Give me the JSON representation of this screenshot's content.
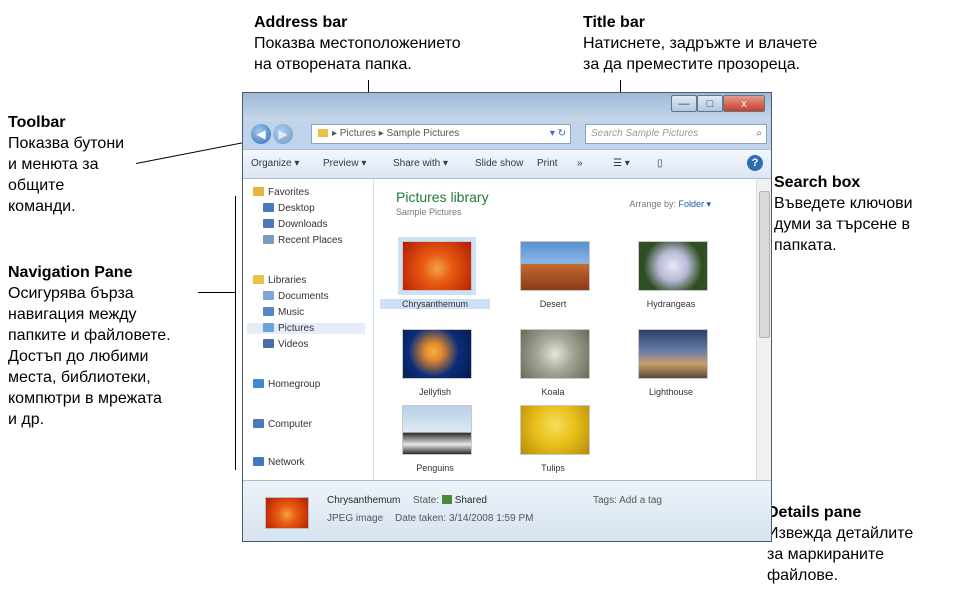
{
  "callouts": {
    "address_bar": {
      "title": "Address bar",
      "lines": [
        "Показва местоположението",
        "на отворената папка."
      ]
    },
    "title_bar": {
      "title": "Title bar",
      "lines": [
        "Натиснете, задръжте и влачете",
        "за да преместите прозореца."
      ]
    },
    "toolbar": {
      "title": "Toolbar",
      "lines": [
        "Показва бутони",
        "и менюта за",
        "общите",
        "команди."
      ]
    },
    "search_box": {
      "title": "Search box",
      "lines": [
        "Въведете ключови",
        "думи за търсене в",
        "папката."
      ]
    },
    "navigation_pane": {
      "title": "Navigation Pane",
      "lines": [
        "Осигурява бърза",
        "навигация между",
        "папките и файловете.",
        "Достъп до любими",
        "места, библиотеки,",
        "компютри в мрежата",
        "и др."
      ]
    },
    "details_pane": {
      "title": "Details pane",
      "lines": [
        "Извежда детайлите",
        "за маркираните",
        "файлове."
      ]
    }
  },
  "window": {
    "caption_buttons": {
      "minimize": "—",
      "maximize": "□",
      "close": "x"
    },
    "address": "▸ Pictures ▸ Sample Pictures",
    "search_placeholder": "Search Sample Pictures",
    "toolbar_items": [
      "Organize ▾",
      "Preview ▾",
      "Share with ▾",
      "Slide show",
      "Print",
      "»",
      "☰ ▾"
    ],
    "navigation": [
      {
        "label": "Favorites",
        "kind": "group",
        "color": "#e8b341"
      },
      {
        "label": "Desktop",
        "kind": "sub",
        "color": "#4a78b8"
      },
      {
        "label": "Downloads",
        "kind": "sub",
        "color": "#4a78b8"
      },
      {
        "label": "Recent Places",
        "kind": "sub",
        "color": "#7a9ac0"
      },
      {
        "label": "Libraries",
        "kind": "group",
        "color": "#e8c34a"
      },
      {
        "label": "Documents",
        "kind": "sub",
        "color": "#7fa6d6"
      },
      {
        "label": "Music",
        "kind": "sub",
        "color": "#5a86c0"
      },
      {
        "label": "Pictures",
        "kind": "sub-selected",
        "color": "#6aa3d8"
      },
      {
        "label": "Videos",
        "kind": "sub",
        "color": "#4a6fa8"
      },
      {
        "label": "Homegroup",
        "kind": "group",
        "color": "#3e8ad0"
      },
      {
        "label": "Computer",
        "kind": "group",
        "color": "#4a78b8"
      },
      {
        "label": "Network",
        "kind": "group",
        "color": "#3e7ac0"
      }
    ],
    "library_title": "Pictures library",
    "library_subtitle": "Sample Pictures",
    "arrange_label": "Arrange by:",
    "arrange_value": "Folder ▾",
    "pictures": [
      {
        "name": "Chrysanthemum",
        "selected": true,
        "colors": [
          "#e85a10",
          "#b01c06"
        ]
      },
      {
        "name": "Desert",
        "selected": false,
        "colors": [
          "#5a8fd0",
          "#b4552a"
        ]
      },
      {
        "name": "Hydrangeas",
        "selected": false,
        "colors": [
          "#2f4f22",
          "#c9c9e0"
        ]
      },
      {
        "name": "Jellyfish",
        "selected": false,
        "colors": [
          "#0a2d7a",
          "#e88b2a"
        ]
      },
      {
        "name": "Koala",
        "selected": false,
        "colors": [
          "#8a8a7a",
          "#d6d6cc"
        ]
      },
      {
        "name": "Lighthouse",
        "selected": false,
        "colors": [
          "#2a3f6a",
          "#c9a06a"
        ]
      },
      {
        "name": "Penguins",
        "selected": false,
        "colors": [
          "#b7d0e8",
          "#2a2a2a"
        ]
      },
      {
        "name": "Tulips",
        "selected": false,
        "colors": [
          "#e8c01a",
          "#b88a0a"
        ]
      }
    ],
    "details": {
      "name": "Chrysanthemum",
      "type": "JPEG image",
      "state_label": "State:",
      "state_value": "Shared",
      "date_label": "Date taken:",
      "date_value": "3/14/2008 1:59 PM",
      "tags_label": "Tags:",
      "tags_value": "Add a tag"
    }
  }
}
